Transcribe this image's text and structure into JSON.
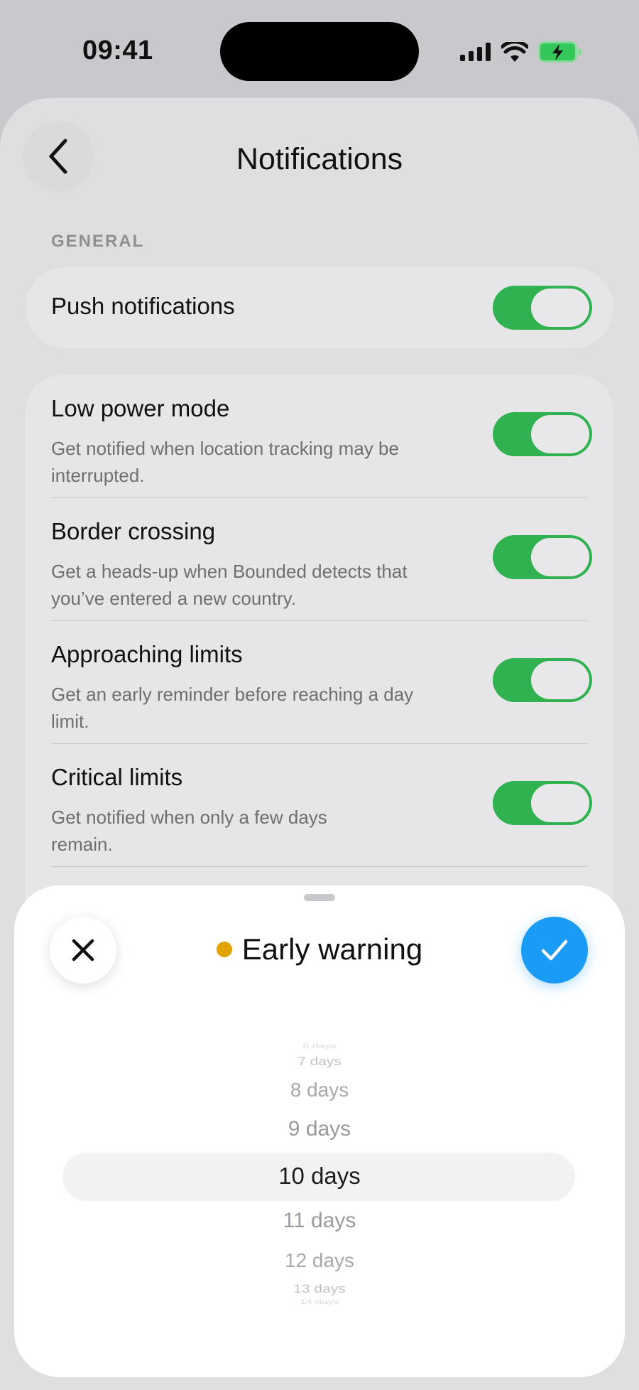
{
  "status_bar": {
    "time": "09:41",
    "icons": [
      "signal-icon",
      "wifi-icon",
      "battery-charging-icon"
    ],
    "battery_color": "#34c759"
  },
  "header": {
    "title": "Notifications",
    "back_icon": "chevron-left-icon"
  },
  "general": {
    "section_label": "GENERAL",
    "push": {
      "label": "Push notifications",
      "enabled": true
    }
  },
  "settings": [
    {
      "title": "Low power mode",
      "description": "Get notified when location tracking may be interrupted.",
      "enabled": true
    },
    {
      "title": "Border crossing",
      "description": "Get a heads-up when Bounded detects that you’ve entered a new country.",
      "enabled": true
    },
    {
      "title": "Approaching limits",
      "description": "Get an early reminder before reaching a day limit.",
      "enabled": true
    },
    {
      "title": "Critical limits",
      "description": "Get notified when only a few days remain.",
      "enabled": true
    }
  ],
  "sheet": {
    "title": "Early warning",
    "dot_color": "#e0a300",
    "close_icon": "close-icon",
    "confirm_icon": "checkmark-icon",
    "accent": "#1a9bf5",
    "picker": {
      "options": [
        "6 days",
        "7 days",
        "8 days",
        "9 days",
        "10 days",
        "11 days",
        "12 days",
        "13 days",
        "14 days"
      ],
      "selected": "10 days"
    }
  },
  "colors": {
    "toggle_on": "#2fb24f"
  }
}
